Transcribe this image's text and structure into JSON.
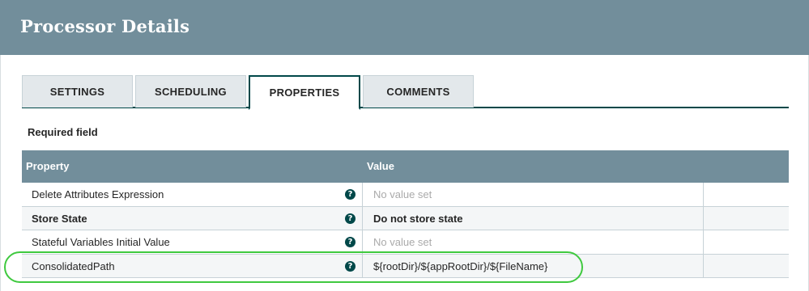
{
  "dialog": {
    "title": "Processor Details"
  },
  "tabs": [
    {
      "label": "SETTINGS",
      "active": false
    },
    {
      "label": "SCHEDULING",
      "active": false
    },
    {
      "label": "PROPERTIES",
      "active": true
    },
    {
      "label": "COMMENTS",
      "active": false
    }
  ],
  "required_field_label": "Required field",
  "table": {
    "headers": {
      "property": "Property",
      "value": "Value"
    },
    "rows": [
      {
        "property": "Delete Attributes Expression",
        "required": false,
        "value": "No value set",
        "value_set": false
      },
      {
        "property": "Store State",
        "required": true,
        "value": "Do not store state",
        "value_set": true
      },
      {
        "property": "Stateful Variables Initial Value",
        "required": false,
        "value": "No value set",
        "value_set": false
      },
      {
        "property": "ConsolidatedPath",
        "required": false,
        "value": "${rootDir}/${appRootDir}/${FileName}",
        "value_set": true
      }
    ]
  },
  "icons": {
    "help": "question-mark-icon"
  },
  "colors": {
    "header_bg": "#728e9b",
    "accent": "#004849",
    "highlight": "#3fc93f"
  }
}
